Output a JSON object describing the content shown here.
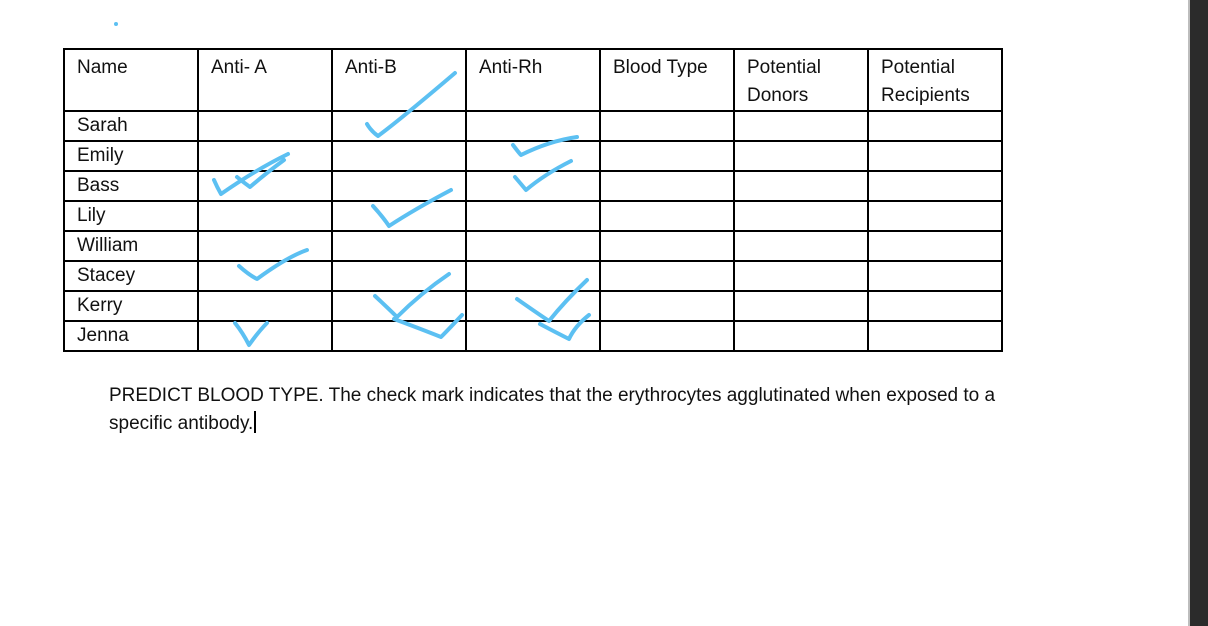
{
  "document": {
    "table": {
      "headers": [
        "Name",
        "Anti- A",
        "Anti-B",
        "Anti-Rh",
        "Blood Type",
        "Potential Donors",
        "Potential Recipients"
      ],
      "rows": [
        {
          "name": "Sarah",
          "anti_a": false,
          "anti_b": true,
          "anti_rh": false,
          "blood_type": "",
          "potential_donors": "",
          "potential_recipients": ""
        },
        {
          "name": "Emily",
          "anti_a": true,
          "anti_b": false,
          "anti_rh": true,
          "blood_type": "",
          "potential_donors": "",
          "potential_recipients": ""
        },
        {
          "name": "Bass",
          "anti_a": true,
          "anti_b": false,
          "anti_rh": true,
          "blood_type": "",
          "potential_donors": "",
          "potential_recipients": ""
        },
        {
          "name": "Lily",
          "anti_a": false,
          "anti_b": true,
          "anti_rh": false,
          "blood_type": "",
          "potential_donors": "",
          "potential_recipients": ""
        },
        {
          "name": "William",
          "anti_a": false,
          "anti_b": false,
          "anti_rh": false,
          "blood_type": "",
          "potential_donors": "",
          "potential_recipients": ""
        },
        {
          "name": "Stacey",
          "anti_a": true,
          "anti_b": false,
          "anti_rh": false,
          "blood_type": "",
          "potential_donors": "",
          "potential_recipients": ""
        },
        {
          "name": "Kerry",
          "anti_a": false,
          "anti_b": true,
          "anti_rh": true,
          "blood_type": "",
          "potential_donors": "",
          "potential_recipients": ""
        },
        {
          "name": "Jenna",
          "anti_a": true,
          "anti_b": true,
          "anti_rh": true,
          "blood_type": "",
          "potential_donors": "",
          "potential_recipients": ""
        }
      ]
    },
    "instructions": "PREDICT BLOOD TYPE. The check mark indicates that the erythrocytes agglutinated when exposed to a specific antibody.",
    "check_mark_icon": "handwritten-check-icon",
    "ink_color": "#5cc0f2"
  }
}
